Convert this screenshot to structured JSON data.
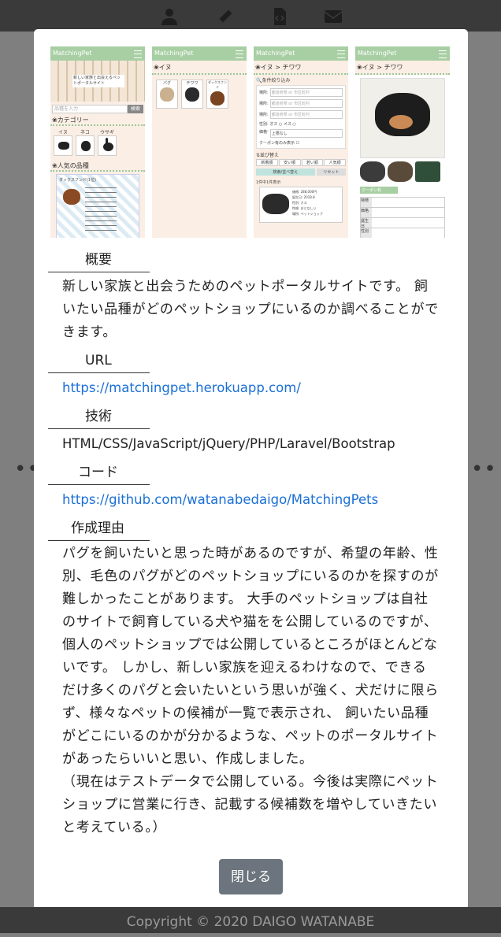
{
  "nav": {
    "icons": [
      "user-icon",
      "pencil-icon",
      "code-file-icon",
      "envelope-icon"
    ]
  },
  "modal": {
    "screenshots": [
      {
        "brand": "MatchingPet",
        "banner": "新しい家族と出会えるペットポータルサイト",
        "search_placeholder": "品種を入力",
        "search_button": "検索",
        "category_title": "カテゴリー",
        "categories": [
          "イヌ",
          "ネコ",
          "ウサギ"
        ],
        "popular_title": "人気の品種",
        "popular_item": "ダックスフンド(1位)"
      },
      {
        "brand": "MatchingPet",
        "crumb": "イヌ",
        "breeds": [
          "パグ",
          "チワワ",
          "ダックスフンド"
        ]
      },
      {
        "brand": "MatchingPet",
        "crumb": "イヌ > チワワ",
        "filter_title": "条件絞り込み",
        "place_label": "場所",
        "place_placeholder": "都道府県 or 市区町村",
        "sex_label": "性別",
        "sex_options": "オス ○ メス ○",
        "price_label": "価格",
        "price_value": "上限なし",
        "coupon_label": "クーポン有のみ表示",
        "sort_title": "並び替え",
        "sort_options": [
          "新着順",
          "安い順",
          "若い順",
          "人気順"
        ],
        "search_button": "検索/並べ替え",
        "reset_button": "リセット",
        "results": "1件中1件表示",
        "result_info": [
          "価格: 288,000円",
          "誕生日: 2018.8",
          "性別: オス",
          "性格: おとなしい",
          "場所: ペットショップ"
        ]
      },
      {
        "brand": "MatchingPet",
        "crumb": "イヌ > チワワ",
        "coupon": "クーポン有",
        "table": [
          "特徴",
          "価格",
          "誕生日",
          "性別",
          "性格"
        ]
      }
    ],
    "sections": {
      "overview_label": "概要",
      "overview_text": "新しい家族と出会うためのペットポータルサイトです。 飼いたい品種がどのペットショップにいるのか調べることができます。",
      "url_label": "URL",
      "url_value": "https://matchingpet.herokuapp.com/",
      "tech_label": "技術",
      "tech_value": "HTML/CSS/JavaScript/jQuery/PHP/Laravel/Bootstrap",
      "code_label": "コード",
      "code_value": "https://github.com/watanabedaigo/MatchingPets",
      "reason_label": "作成理由",
      "reason_text": "パグを飼いたいと思った時があるのですが、希望の年齢、性別、毛色のパグがどのペットショップにいるのかを探すのが難しかったことがあります。 大手のペットショップは自社のサイトで飼育している犬や猫をを公開しているのですが、個人のペットショップでは公開しているところがほとんどないです。 しかし、新しい家族を迎えるわけなので、できるだけ多くのパグと会いたいという思いが強く、犬だけに限らず、様々なペットの候補が一覧で表示され、 飼いたい品種がどこにいるのかが分かるような、ペットのポータルサイトがあったらいいと思い、作成しました。",
      "reason_note": "（現在はテストデータで公開している。今後は実際にペットショップに営業に行き、記載する候補数を増やしていきたいと考えている。）"
    },
    "close_label": "閉じる"
  },
  "footer": {
    "copyright": "Copyright © 2020 DAIGO WATANABE"
  },
  "colors": {
    "overlay": "#7f7f7f",
    "nav_bg": "#3a3a3a",
    "link": "#1a6fd6",
    "button": "#6c757d",
    "mock_header": "#a8cfa3",
    "mock_bg": "#fbeee4"
  }
}
